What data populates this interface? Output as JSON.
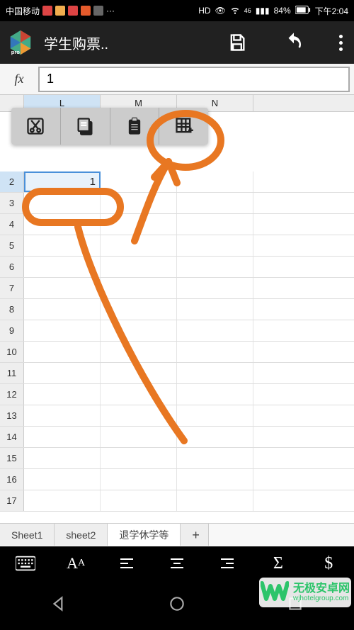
{
  "status": {
    "carrier": "中国移动",
    "hd": "HD",
    "signal": "46",
    "battery": "84%",
    "time": "下午2:04"
  },
  "app": {
    "title": "学生购票.."
  },
  "formula": {
    "fx": "fx",
    "value": "1"
  },
  "grid": {
    "cols": [
      "L",
      "M",
      "N"
    ],
    "rows": [
      "2",
      "3",
      "4",
      "5",
      "6",
      "7",
      "8",
      "9",
      "10",
      "11",
      "12",
      "13",
      "14",
      "15",
      "16",
      "17"
    ],
    "selected_row": "2",
    "cell_value": "1"
  },
  "tabs": {
    "items": [
      "Sheet1",
      "sheet2",
      "退学休学等"
    ],
    "active": 2,
    "add": "+"
  },
  "popup": {
    "items": [
      "cut-icon",
      "copy-icon",
      "paste-icon",
      "insert-cell-icon"
    ]
  },
  "format_bar": {
    "items": [
      "keyboard-icon",
      "font-icon",
      "align-left-icon",
      "align-center-icon",
      "align-right-icon",
      "sum-icon",
      "currency-icon"
    ]
  },
  "watermark": {
    "main": "无极安卓网",
    "sub": "wjhotelgroup.com"
  }
}
